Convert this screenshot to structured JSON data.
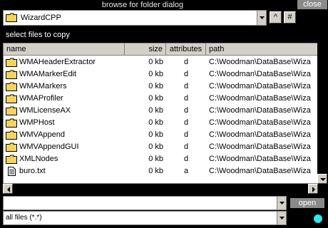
{
  "window": {
    "title": "browse for folder dialog",
    "close_label": "close"
  },
  "folder": {
    "current": "WizardCPP"
  },
  "toolbar": {
    "up_label": "^",
    "hash_label": "#"
  },
  "caption": "select files to copy",
  "columns": {
    "name": "name",
    "size": "size",
    "attributes": "attributes",
    "path": "path"
  },
  "files": [
    {
      "name": "WMAHeaderExtractor",
      "size": "0 kb",
      "attr": "d",
      "path": "C:\\Woodman\\DataBase\\Wiza",
      "icon": "folder-icon"
    },
    {
      "name": "WMAMarkerEdit",
      "size": "0 kb",
      "attr": "d",
      "path": "C:\\Woodman\\DataBase\\Wiza",
      "icon": "folder-icon"
    },
    {
      "name": "WMAMarkers",
      "size": "0 kb",
      "attr": "d",
      "path": "C:\\Woodman\\DataBase\\Wiza",
      "icon": "folder-icon"
    },
    {
      "name": "WMAProfiler",
      "size": "0 kb",
      "attr": "d",
      "path": "C:\\Woodman\\DataBase\\Wiza",
      "icon": "folder-icon"
    },
    {
      "name": "WMLicenseAX",
      "size": "0 kb",
      "attr": "d",
      "path": "C:\\Woodman\\DataBase\\Wiza",
      "icon": "folder-icon"
    },
    {
      "name": "WMPHost",
      "size": "0 kb",
      "attr": "d",
      "path": "C:\\Woodman\\DataBase\\Wiza",
      "icon": "folder-icon"
    },
    {
      "name": "WMVAppend",
      "size": "0 kb",
      "attr": "d",
      "path": "C:\\Woodman\\DataBase\\Wiza",
      "icon": "folder-icon"
    },
    {
      "name": "WMVAppendGUI",
      "size": "0 kb",
      "attr": "d",
      "path": "C:\\Woodman\\DataBase\\Wiza",
      "icon": "folder-icon"
    },
    {
      "name": "XMLNodes",
      "size": "0 kb",
      "attr": "d",
      "path": "C:\\Woodman\\DataBase\\Wiza",
      "icon": "folder-icon"
    },
    {
      "name": "buro.txt",
      "size": "0 kb",
      "attr": "a",
      "path": "C:\\Woodman\\DataBase\\Wiza",
      "icon": "text-file-icon"
    }
  ],
  "filename_input": {
    "value": ""
  },
  "filter": {
    "selected": "all files (*.*)"
  },
  "open_label": "open",
  "colors": {
    "background": "#000000",
    "panel": "#d4d0c8",
    "button": "#8a8a8a",
    "status": "#2ee6ee"
  }
}
